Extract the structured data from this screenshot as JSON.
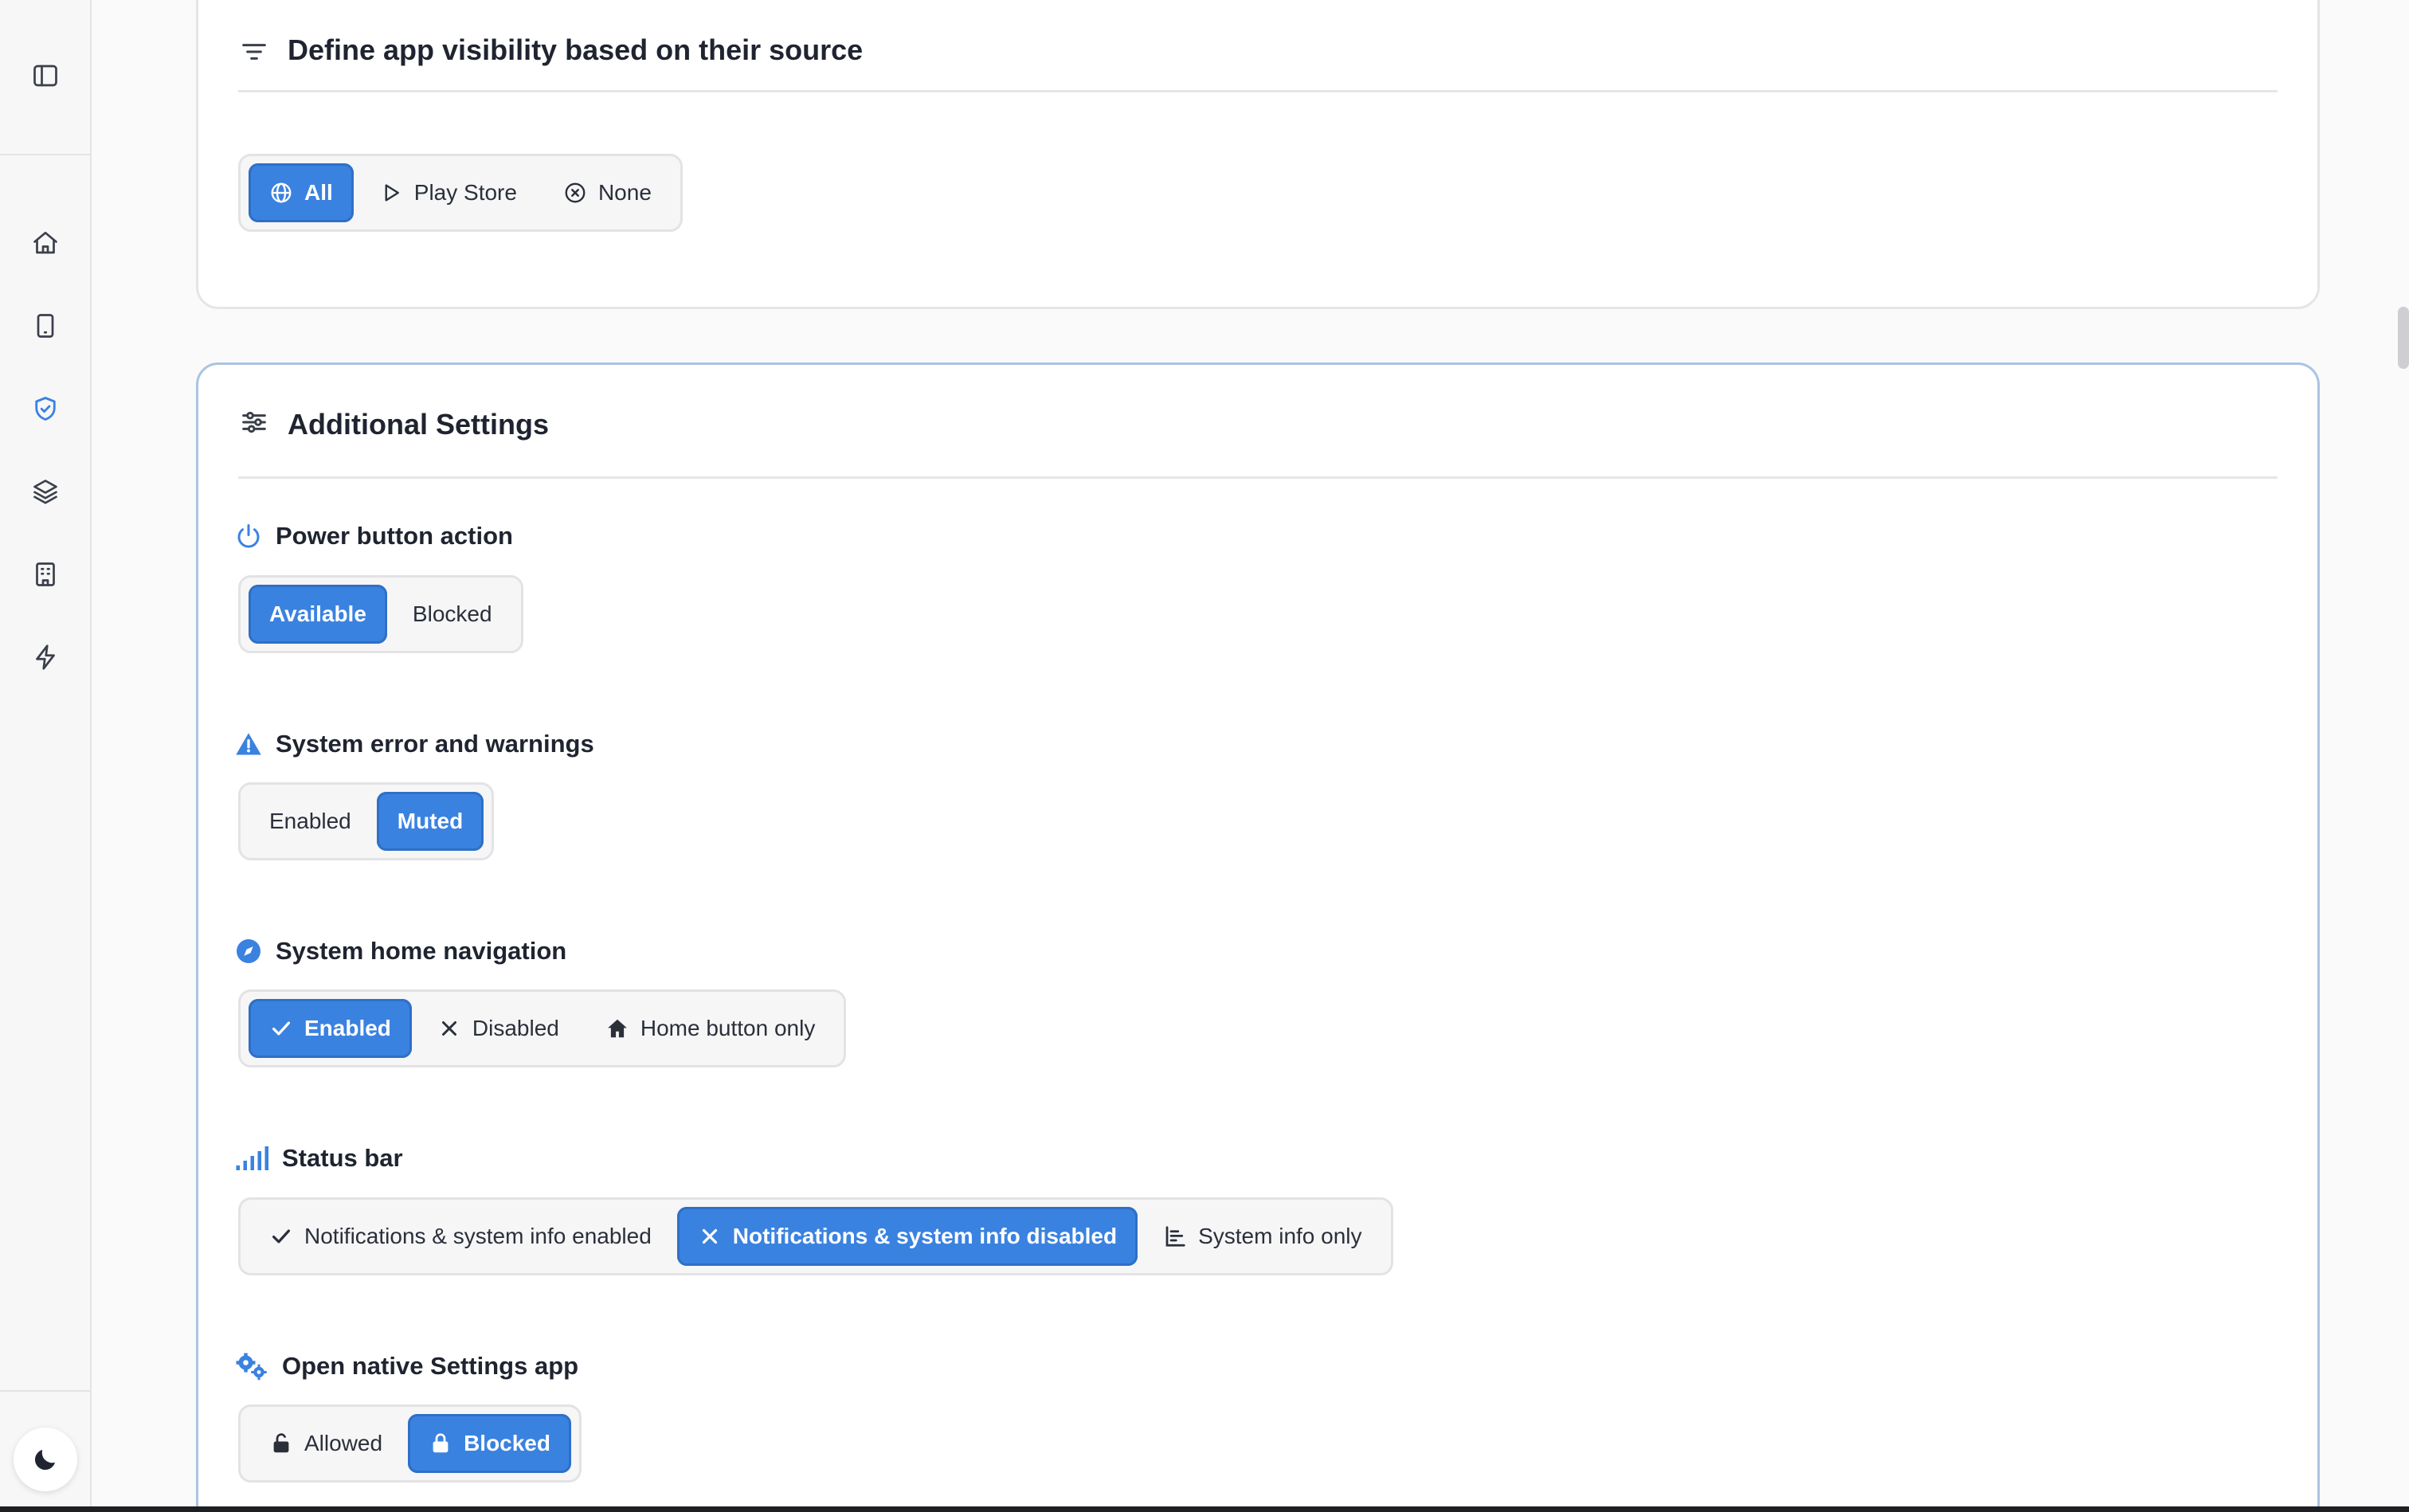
{
  "sidebar": {
    "toggle_icon": "sidebar-toggle-icon",
    "items": [
      {
        "name": "home",
        "icon": "home-icon"
      },
      {
        "name": "devices",
        "icon": "tablet-icon"
      },
      {
        "name": "policies",
        "icon": "shield-check-icon",
        "active": true
      },
      {
        "name": "layers",
        "icon": "layers-icon"
      },
      {
        "name": "organization",
        "icon": "building-icon"
      },
      {
        "name": "automation",
        "icon": "lightning-icon"
      }
    ],
    "theme_icon": "moon-icon"
  },
  "source_card": {
    "title": "Define app visibility based on their source",
    "icon": "filter-lines-icon",
    "options": [
      {
        "label": "All",
        "icon": "globe-icon",
        "selected": true
      },
      {
        "label": "Play Store",
        "icon": "play-icon",
        "selected": false
      },
      {
        "label": "None",
        "icon": "circle-x-icon",
        "selected": false
      }
    ]
  },
  "additional_settings": {
    "title": "Additional Settings",
    "icon": "sliders-icon",
    "power_button": {
      "label": "Power button action",
      "icon": "power-icon",
      "options": [
        {
          "label": "Available",
          "selected": true
        },
        {
          "label": "Blocked",
          "selected": false
        }
      ]
    },
    "system_errors": {
      "label": "System error and warnings",
      "icon": "warning-triangle-icon",
      "options": [
        {
          "label": "Enabled",
          "selected": false
        },
        {
          "label": "Muted",
          "selected": true
        }
      ]
    },
    "home_navigation": {
      "label": "System home navigation",
      "icon": "compass-icon",
      "options": [
        {
          "label": "Enabled",
          "icon": "check-icon",
          "selected": true
        },
        {
          "label": "Disabled",
          "icon": "x-icon",
          "selected": false
        },
        {
          "label": "Home button only",
          "icon": "house-icon",
          "selected": false
        }
      ]
    },
    "status_bar": {
      "label": "Status bar",
      "icon": "signal-bars-icon",
      "options": [
        {
          "label": "Notifications & system info enabled",
          "icon": "check-icon",
          "selected": false
        },
        {
          "label": "Notifications & system info disabled",
          "icon": "x-icon",
          "selected": true
        },
        {
          "label": "System info only",
          "icon": "chart-icon",
          "selected": false
        }
      ]
    },
    "settings_app": {
      "label": "Open native Settings app",
      "icon": "gears-icon",
      "options": [
        {
          "label": "Allowed",
          "icon": "lock-open-icon",
          "selected": false
        },
        {
          "label": "Blocked",
          "icon": "lock-icon",
          "selected": true
        }
      ]
    }
  },
  "colors": {
    "accent": "#3a82e0",
    "accent_border": "#2f6fc6",
    "active_card_border": "#aac4e2",
    "sidebar_bg": "#f7f7f8"
  }
}
